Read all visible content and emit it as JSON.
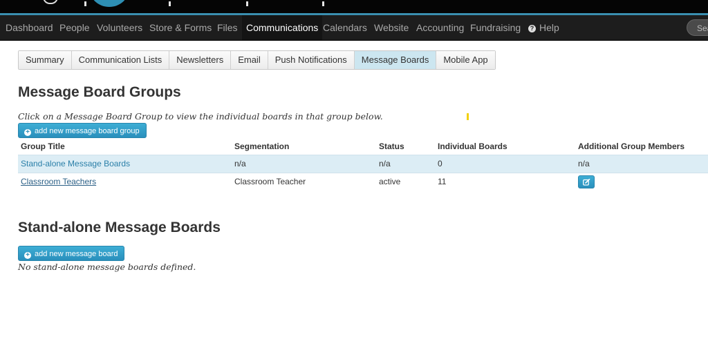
{
  "nav": {
    "items": [
      "Dashboard",
      "People",
      "Volunteers",
      "Store & Forms",
      "Files",
      "Communications",
      "Calendars",
      "Website",
      "Accounting",
      "Fundraising",
      "Help"
    ],
    "active": "Communications",
    "search_placeholder": "Sea"
  },
  "tabs": {
    "items": [
      "Summary",
      "Communication Lists",
      "Newsletters",
      "Email",
      "Push Notifications",
      "Message Boards",
      "Mobile App"
    ],
    "active": "Message Boards"
  },
  "groups": {
    "title": "Message Board Groups",
    "intro": "Click on a Message Board Group to view the individual boards in that group below.",
    "add_button": "add new message board group",
    "columns": [
      "Group Title",
      "Segmentation",
      "Status",
      "Individual Boards",
      "Additional Group Members"
    ],
    "rows": [
      [
        "Stand-alone Message Boards",
        "n/a",
        "n/a",
        "0",
        "n/a"
      ],
      [
        "Classroom Teachers",
        "Classroom Teacher",
        "active",
        "11",
        ""
      ]
    ]
  },
  "standalone": {
    "title": "Stand-alone Message Boards",
    "add_button": "add new message board",
    "empty_text": "No stand-alone message boards defined."
  },
  "colors": {
    "accent": "#2a8fbc",
    "active_tab": "#cce6f0",
    "striped_row": "#dcedf5",
    "nav_bg": "#1d1d1d"
  },
  "icons": {
    "help": "help-icon",
    "add": "plus-circle-icon",
    "edit": "edit-icon"
  }
}
